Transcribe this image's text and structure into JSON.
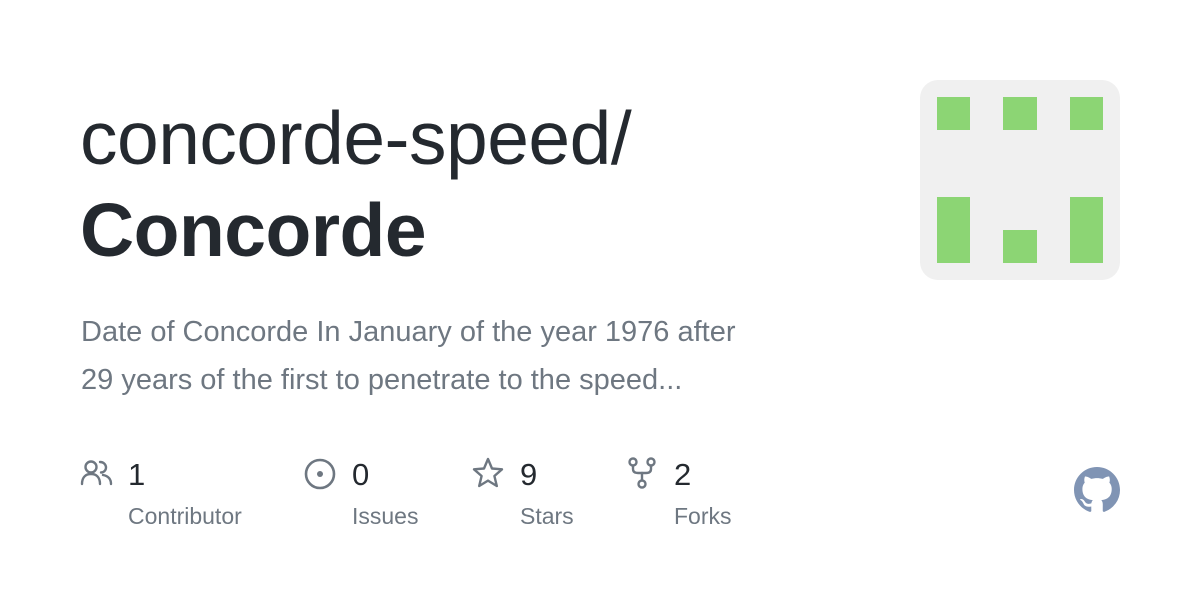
{
  "header": {
    "owner": "concorde-speed/",
    "repo": "Concorde"
  },
  "description": {
    "line1": "Date of Concorde In January of the year 1976 after",
    "line2": "29 years of the first to penetrate to the speed..."
  },
  "stats": [
    {
      "icon": "people-icon",
      "count": "1",
      "label": "Contributor"
    },
    {
      "icon": "issue-icon",
      "count": "0",
      "label": "Issues"
    },
    {
      "icon": "star-icon",
      "count": "9",
      "label": "Stars"
    },
    {
      "icon": "fork-icon",
      "count": "2",
      "label": "Forks"
    }
  ],
  "colors": {
    "text": "#24292f",
    "muted": "#6e7781",
    "identicon_fill": "#8cd574",
    "identicon_bg": "#f0f0f0",
    "github_logo": "#8094b4"
  },
  "logo": {
    "icon": "github-mark-icon"
  }
}
